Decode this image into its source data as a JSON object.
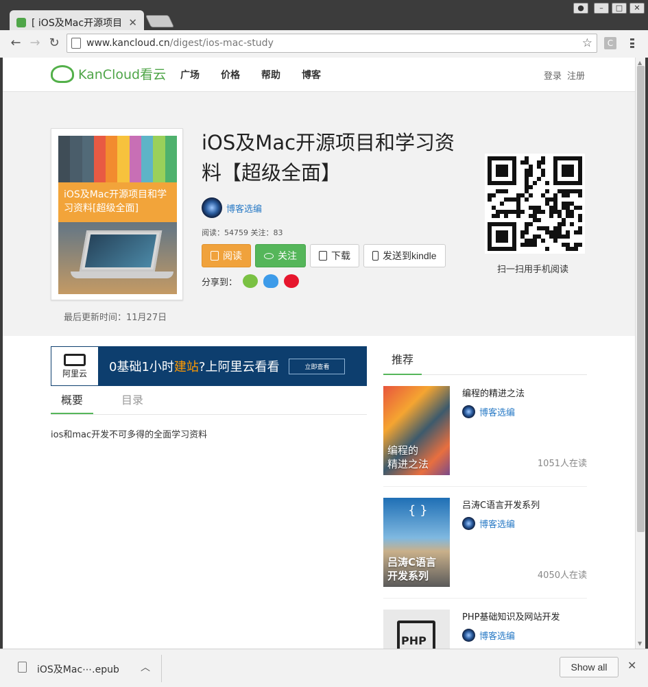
{
  "browser": {
    "tab_title": "[ iOS及Mac开源项目",
    "url_domain": "www.kancloud.cn",
    "url_path": "/digest/ios-mac-study",
    "ext_label": "C"
  },
  "site": {
    "logo_text": "KanCloud看云",
    "nav": [
      "广场",
      "价格",
      "帮助",
      "博客"
    ],
    "login": "登录",
    "register": "注册"
  },
  "book": {
    "title": "iOS及Mac开源项目和学习资料【超级全面】",
    "cover_text": "iOS及Mac开源项目和学习资料[超级全面]",
    "author": "博客选编",
    "stats": "阅读：54759 关注：83",
    "update_time": "最后更新时间：11月27日",
    "buttons": {
      "read": "阅读",
      "follow": "关注",
      "download": "下载",
      "kindle": "发送到kindle"
    },
    "share_label": "分享到：",
    "qr_label": "扫一扫用手机阅读"
  },
  "ad": {
    "logo_text": "阿里云",
    "text_before": "0基础1小时",
    "text_highlight": "建站",
    "text_after": "?上阿里云看看",
    "cta": "立即查看"
  },
  "content": {
    "tabs": [
      "概要",
      "目录"
    ],
    "summary": "ios和mac开发不可多得的全面学习资料"
  },
  "recommend": {
    "heading": "推荐",
    "items": [
      {
        "title": "编程的精进之法",
        "cover_text": "编程的\n精进之法",
        "author": "博客选编",
        "count": "1051人在读"
      },
      {
        "title": "吕涛C语言开发系列",
        "cover_text": "吕涛C语言\n开发系列",
        "author": "博客选编",
        "count": "4050人在读"
      },
      {
        "title": "PHP基础知识及网站开发",
        "cover_text": "PHP",
        "author": "博客选编",
        "count": ""
      }
    ]
  },
  "shelf": {
    "file_name": "iOS及Mac⋯.epub",
    "show_all": "Show all"
  },
  "colors": {
    "brand_green": "#55b65a",
    "orange": "#f0a23c",
    "link_blue": "#2a7bc6"
  }
}
